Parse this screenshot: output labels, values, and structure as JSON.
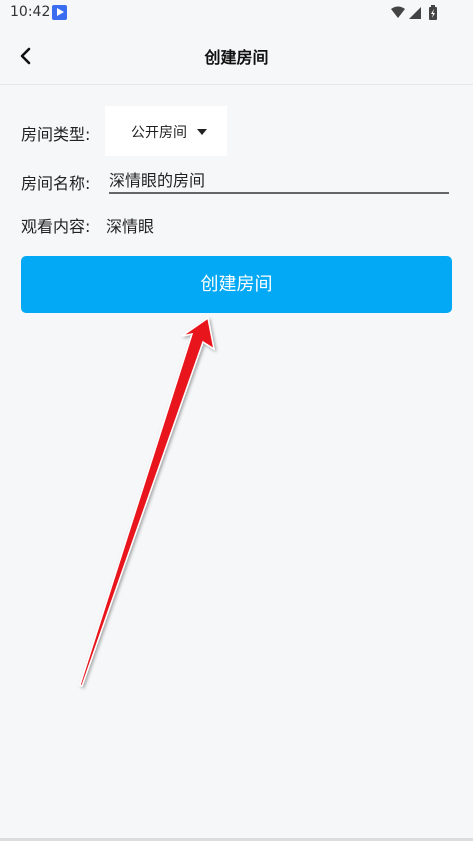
{
  "status_bar": {
    "time": "10:42"
  },
  "header": {
    "title": "创建房间"
  },
  "form": {
    "room_type_label": "房间类型:",
    "room_type_value": "公开房间",
    "room_name_label": "房间名称:",
    "room_name_value": "深情眼的房间",
    "content_label": "观看内容:",
    "content_value": "深情眼"
  },
  "actions": {
    "create_label": "创建房间"
  },
  "colors": {
    "primary": "#03a9f4",
    "arrow": "#e8141b"
  }
}
